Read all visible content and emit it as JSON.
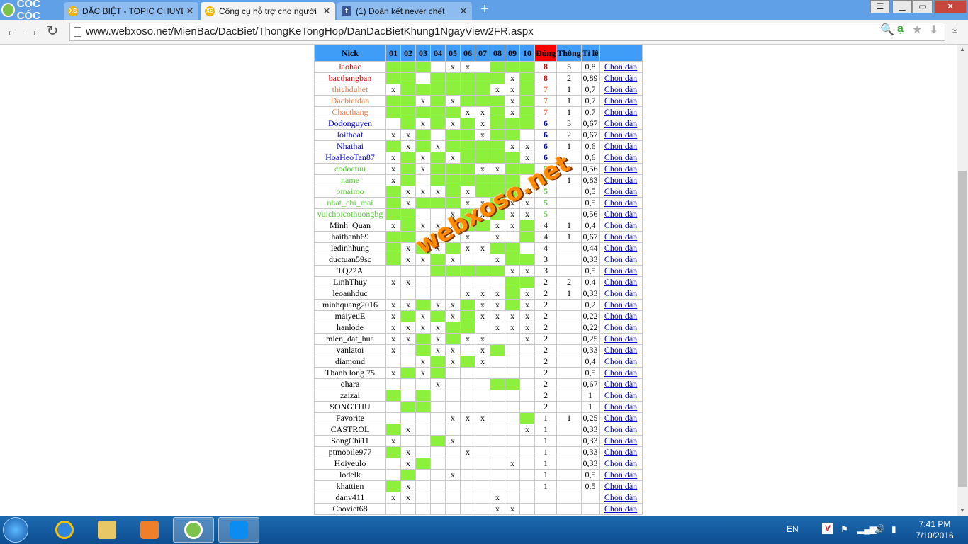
{
  "browser": {
    "logo": "CỐC CỐC",
    "tabs": [
      {
        "title": "ĐẶC BIỆT - TOPIC CHUYÊN",
        "icon": "xs-icon",
        "active": false
      },
      {
        "title": "Công cụ hỗ trợ cho người",
        "icon": "xs-icon",
        "active": true
      },
      {
        "title": "(1) Đoàn kết never chết",
        "icon": "facebook-icon",
        "active": false
      }
    ],
    "url": "www.webxoso.net/MienBac/DacBiet/ThongKeTongHop/DanDacBietKhung1NgayView2FR.aspx"
  },
  "table": {
    "headers": {
      "nick": "Nick",
      "cols": [
        "01",
        "02",
        "03",
        "04",
        "05",
        "06",
        "07",
        "08",
        "09",
        "10"
      ],
      "dung": "Đúng",
      "thong": "Thông",
      "tile": "Tỉ lệ"
    },
    "rows": [
      {
        "nick": "laohac",
        "color": "red",
        "cells": "ggg xx gggg",
        "dung": "8",
        "thong": "5",
        "tile": "0,8"
      },
      {
        "nick": "bacthangban",
        "color": "red",
        "cells": "gg gggggxgg",
        "dung": "8",
        "thong": "2",
        "tile": "0,89"
      },
      {
        "nick": "thichduhet",
        "color": "orange",
        "cells": "xggggggxxg",
        "dung": "7",
        "thong": "1",
        "tile": "0,7"
      },
      {
        "nick": "Dacbietdan",
        "color": "orange",
        "cells": "ggxgxgggxg",
        "dung": "7",
        "thong": "1",
        "tile": "0,7"
      },
      {
        "nick": "Chacthang",
        "color": "orange",
        "cells": "gggggxxgxg",
        "dung": "7",
        "thong": "1",
        "tile": "0,7"
      },
      {
        "nick": "Dodonguyen",
        "color": "blue",
        "cells": " gxgxgxggg",
        "dung": "6",
        "thong": "3",
        "tile": "0,67"
      },
      {
        "nick": "loithoat",
        "color": "blue",
        "cells": "xxg ggxgg",
        "dung": "6",
        "thong": "2",
        "tile": "0,67"
      },
      {
        "nick": "Nhathai",
        "color": "blue",
        "cells": "gxgxggggxx",
        "dung": "6",
        "thong": "1",
        "tile": "0,6"
      },
      {
        "nick": "HoaHeoTan87",
        "color": "blue",
        "cells": "xgxgxggggx",
        "dung": "6",
        "thong": "",
        "tile": "0,6"
      },
      {
        "nick": "codoctuu",
        "color": "green",
        "cells": "xgxgggxxgg",
        "dung": "5",
        "thong": "1",
        "tile": "0,56"
      },
      {
        "nick": "name",
        "color": "green",
        "cells": "xg gggggg",
        "dung": "5",
        "thong": "1",
        "tile": "0,83"
      },
      {
        "nick": "omaimo",
        "color": "green",
        "cells": "gxxxgxgggx",
        "dung": "5",
        "thong": "",
        "tile": "0,5"
      },
      {
        "nick": "nhat_chi_mai",
        "color": "green",
        "cells": "gxgggxxgxx",
        "dung": "5",
        "thong": "",
        "tile": "0,5"
      },
      {
        "nick": "vuichoicothuongbg",
        "color": "green",
        "cells": "gg  xgxgxx",
        "dung": "5",
        "thong": "",
        "tile": "0,56"
      },
      {
        "nick": "Minh_Quan",
        "color": "black",
        "cells": "xgxxxggxxg",
        "dung": "4",
        "thong": "1",
        "tile": "0,4"
      },
      {
        "nick": "haithanh69",
        "color": "black",
        "cells": "gg   x x g",
        "dung": "4",
        "thong": "1",
        "tile": "0,67"
      },
      {
        "nick": "ledinhhung",
        "color": "black",
        "cells": "gxgxgxxgg ",
        "dung": "4",
        "thong": "",
        "tile": "0,44"
      },
      {
        "nick": "ductuan59sc",
        "color": "black",
        "cells": "gxxgx  xgg",
        "dung": "3",
        "thong": "",
        "tile": "0,33"
      },
      {
        "nick": "TQ22A",
        "color": "black",
        "cells": "   gggggxx",
        "dung": "3",
        "thong": "",
        "tile": "0,5"
      },
      {
        "nick": "LinhThuy",
        "color": "black",
        "cells": "xx      gg",
        "dung": "2",
        "thong": "2",
        "tile": "0,4"
      },
      {
        "nick": "leoanhduc",
        "color": "black",
        "cells": "     xxxgx",
        "dung": "2",
        "thong": "1",
        "tile": "0,33"
      },
      {
        "nick": "minhquang2016",
        "color": "black",
        "cells": "xxgxxgxxgx",
        "dung": "2",
        "thong": "",
        "tile": "0,2"
      },
      {
        "nick": "maiyeuE",
        "color": "black",
        "cells": "xgxgxgxxxx",
        "dung": "2",
        "thong": "",
        "tile": "0,22"
      },
      {
        "nick": "hanlode",
        "color": "black",
        "cells": "xxxxgg xxx",
        "dung": "2",
        "thong": "",
        "tile": "0,22"
      },
      {
        "nick": "mien_dat_hua",
        "color": "black",
        "cells": "xxgxgxx  x",
        "dung": "2",
        "thong": "",
        "tile": "0,25"
      },
      {
        "nick": "vanlatoi",
        "color": "black",
        "cells": "x gxx xg  ",
        "dung": "2",
        "thong": "",
        "tile": "0,33"
      },
      {
        "nick": "diamond",
        "color": "black",
        "cells": "  xgxgx   ",
        "dung": "2",
        "thong": "",
        "tile": "0,4"
      },
      {
        "nick": "Thanh long 75",
        "color": "black",
        "cells": "xgxg      ",
        "dung": "2",
        "thong": "",
        "tile": "0,5"
      },
      {
        "nick": "ohara",
        "color": "black",
        "cells": "   x   gg ",
        "dung": "2",
        "thong": "",
        "tile": "0,67"
      },
      {
        "nick": "zaizai",
        "color": "black",
        "cells": "g g       ",
        "dung": "2",
        "thong": "",
        "tile": "1"
      },
      {
        "nick": "SONGTHU",
        "color": "black",
        "cells": " gg       ",
        "dung": "2",
        "thong": "",
        "tile": "1"
      },
      {
        "nick": "Favorite",
        "color": "black",
        "cells": "    xxx  g",
        "dung": "1",
        "thong": "1",
        "tile": "0,25"
      },
      {
        "nick": "CASTROL",
        "color": "black",
        "cells": "gx       x",
        "dung": "1",
        "thong": "",
        "tile": "0,33"
      },
      {
        "nick": "SongChi11",
        "color": "black",
        "cells": "x  gx     ",
        "dung": "1",
        "thong": "",
        "tile": "0,33"
      },
      {
        "nick": "ptmobile977",
        "color": "black",
        "cells": "gx   x    ",
        "dung": "1",
        "thong": "",
        "tile": "0,33"
      },
      {
        "nick": "Hoiyeulo",
        "color": "black",
        "cells": " xg     x ",
        "dung": "1",
        "thong": "",
        "tile": "0,33"
      },
      {
        "nick": "lodelk",
        "color": "black",
        "cells": " g  x     ",
        "dung": "1",
        "thong": "",
        "tile": "0,5"
      },
      {
        "nick": "khattien",
        "color": "black",
        "cells": "gx        ",
        "dung": "1",
        "thong": "",
        "tile": "0,5"
      },
      {
        "nick": "danv411",
        "color": "black",
        "cells": "xx     x  ",
        "dung": "",
        "thong": "",
        "tile": ""
      },
      {
        "nick": "Caoviet68",
        "color": "black",
        "cells": "       xx ",
        "dung": "",
        "thong": "",
        "tile": ""
      }
    ],
    "action_label": "Chon dàn"
  },
  "watermark": "webxoso.net",
  "taskbar": {
    "lang": "EN",
    "time": "7:41 PM",
    "date": "7/10/2016"
  }
}
